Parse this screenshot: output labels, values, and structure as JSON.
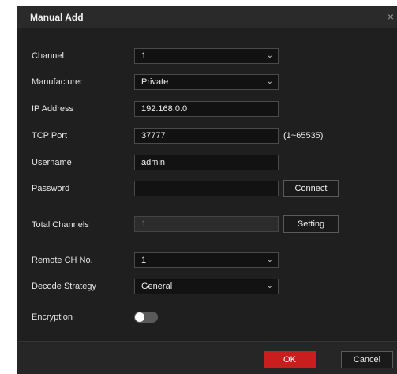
{
  "dialog": {
    "title": "Manual Add",
    "close_icon": "close-icon",
    "close_glyph": "×"
  },
  "form": {
    "channel": {
      "label": "Channel",
      "value": "1"
    },
    "manufacturer": {
      "label": "Manufacturer",
      "value": "Private"
    },
    "ip_address": {
      "label": "IP Address",
      "value": "192.168.0.0"
    },
    "tcp_port": {
      "label": "TCP Port",
      "value": "37777",
      "hint": "(1~65535)"
    },
    "username": {
      "label": "Username",
      "value": "admin"
    },
    "password": {
      "label": "Password",
      "value": "",
      "button": "Connect"
    },
    "total_channels": {
      "label": "Total Channels",
      "value": "1",
      "button": "Setting"
    },
    "remote_ch_no": {
      "label": "Remote CH No.",
      "value": "1"
    },
    "decode_strategy": {
      "label": "Decode Strategy",
      "value": "General"
    },
    "encryption": {
      "label": "Encryption",
      "enabled": false
    }
  },
  "footer": {
    "ok_label": "OK",
    "cancel_label": "Cancel"
  },
  "colors": {
    "accent": "#c81e1e",
    "dialog_bg": "#1f1f1f"
  },
  "icons": {
    "chevron": "chevron-down-icon"
  }
}
